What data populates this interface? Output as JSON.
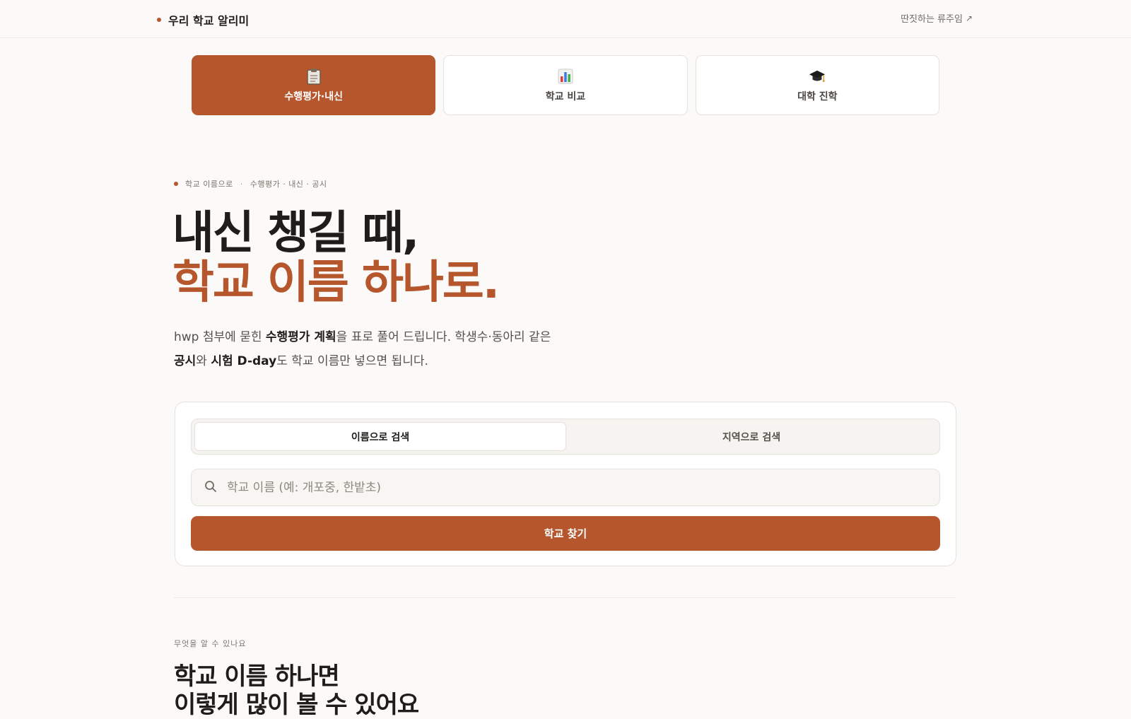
{
  "header": {
    "brand": "우리 학교 알리미",
    "author_link": "딴짓하는 류주임"
  },
  "tabs": [
    {
      "label": "수행평가·내신",
      "icon": "clipboard-icon",
      "active": true
    },
    {
      "label": "학교 비교",
      "icon": "bar-chart-icon",
      "active": false
    },
    {
      "label": "대학 진학",
      "icon": "graduation-cap-icon",
      "active": false
    }
  ],
  "hero": {
    "eyebrow_left": "학교 이름으로",
    "eyebrow_sep": "·",
    "eyebrow_right": "수행평가 · 내신 · 공시",
    "title_line1": "내신 챙길 때,",
    "title_line2": "학교 이름 하나로.",
    "desc": {
      "p1": "hwp 첨부에 묻힌 ",
      "b1": "수행평가 계획",
      "p2": "을 표로 풀어 드립니다. 학생수·동아리 같은",
      "b2": "공시",
      "p3": "와 ",
      "b3": "시험 D-day",
      "p4": "도 학교 이름만 넣으면 됩니다."
    }
  },
  "search": {
    "mode_name": "이름으로 검색",
    "mode_region": "지역으로 검색",
    "placeholder": "학교 이름 (예: 개포중, 한밭초)",
    "value": "",
    "submit_label": "학교 찾기"
  },
  "section": {
    "eyebrow": "무엇을 알 수 있나요",
    "title_line1": "학교 이름 하나면",
    "title_line2": "이렇게 많이 볼 수 있어요"
  },
  "colors": {
    "accent": "#b5562d",
    "background": "#fbfaf8"
  }
}
